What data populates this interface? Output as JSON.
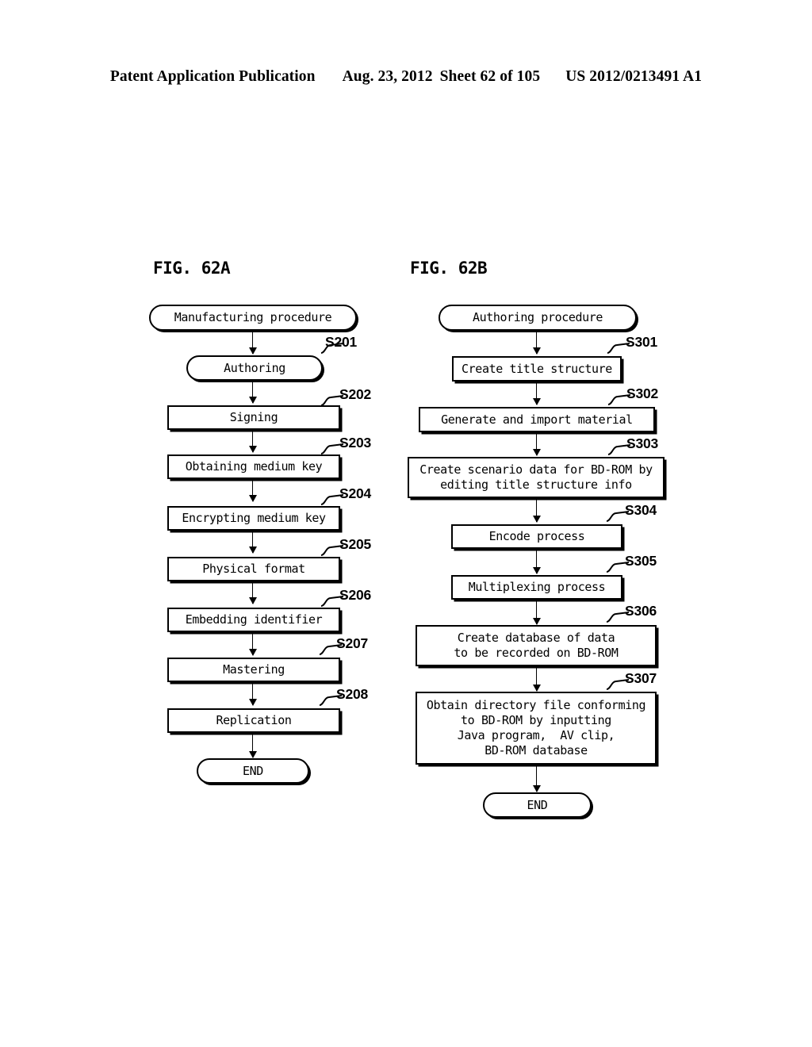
{
  "header": {
    "publication": "Patent Application Publication",
    "date": "Aug. 23, 2012",
    "sheet": "Sheet 62 of 105",
    "patent_number": "US 2012/0213491 A1"
  },
  "figures": [
    {
      "label": "FIG. 62A",
      "nodes": [
        {
          "id": "start",
          "shape": "stadium",
          "text": "Manufacturing procedure",
          "step": null
        },
        {
          "id": "s201",
          "shape": "stadium",
          "text": "Authoring",
          "step": "S201"
        },
        {
          "id": "s202",
          "shape": "rectangle",
          "text": "Signing",
          "step": "S202"
        },
        {
          "id": "s203",
          "shape": "rectangle",
          "text": "Obtaining medium key",
          "step": "S203"
        },
        {
          "id": "s204",
          "shape": "rectangle",
          "text": "Encrypting medium key",
          "step": "S204"
        },
        {
          "id": "s205",
          "shape": "rectangle",
          "text": "Physical format",
          "step": "S205"
        },
        {
          "id": "s206",
          "shape": "rectangle",
          "text": "Embedding identifier",
          "step": "S206"
        },
        {
          "id": "s207",
          "shape": "rectangle",
          "text": "Mastering",
          "step": "S207"
        },
        {
          "id": "s208",
          "shape": "rectangle",
          "text": "Replication",
          "step": "S208"
        },
        {
          "id": "end",
          "shape": "stadium",
          "text": "END",
          "step": null
        }
      ]
    },
    {
      "label": "FIG. 62B",
      "nodes": [
        {
          "id": "start",
          "shape": "stadium",
          "text": "Authoring procedure",
          "step": null
        },
        {
          "id": "s301",
          "shape": "rectangle",
          "text": "Create title structure",
          "step": "S301"
        },
        {
          "id": "s302",
          "shape": "rectangle",
          "text": "Generate and import material",
          "step": "S302"
        },
        {
          "id": "s303",
          "shape": "rectangle",
          "text": "Create scenario data for BD-ROM by\neditiong",
          "step": "S303",
          "lines": [
            "Create scenario data for BD-ROM by",
            "editing title structure info"
          ]
        },
        {
          "id": "s304",
          "shape": "rectangle",
          "text": "Encode process",
          "step": "S304"
        },
        {
          "id": "s305",
          "shape": "rectangle",
          "text": "Multiplexing process",
          "step": "S305"
        },
        {
          "id": "s306",
          "shape": "rectangle",
          "text": "Create database of data",
          "step": "S306",
          "lines": [
            "Create database of data",
            "to be recorded on BD-ROM"
          ]
        },
        {
          "id": "s307",
          "shape": "rectangle",
          "text": "Obtain directory file conforming",
          "step": "S307",
          "lines": [
            "Obtain directory file conforming",
            "to BD-ROM by inputting",
            "Java program,  AV clip,",
            "BD-ROM database"
          ]
        },
        {
          "id": "end",
          "shape": "stadium",
          "text": "END",
          "step": null
        }
      ]
    }
  ],
  "figA": {
    "label": "FIG. 62A",
    "start": "Manufacturing procedure",
    "s201": "Authoring",
    "s202": "Signing",
    "s203": "Obtaining medium key",
    "s204": "Encrypting medium key",
    "s205": "Physical format",
    "s206": "Embedding identifier",
    "s207": "Mastering",
    "s208": "Replication",
    "end": "END",
    "step201": "S201",
    "step202": "S202",
    "step203": "S203",
    "step204": "S204",
    "step205": "S205",
    "step206": "S206",
    "step207": "S207",
    "step208": "S208"
  },
  "figB": {
    "label": "FIG. 62B",
    "start": "Authoring procedure",
    "s301": "Create title structure",
    "s302": "Generate and import material",
    "s303_line1": "Create scenario data for BD-ROM by",
    "s303_line2": "editing title structure info",
    "s304": "Encode process",
    "s305": "Multiplexing process",
    "s306_line1": "Create database of data",
    "s306_line2": "to be recorded on BD-ROM",
    "s307_line1": "Obtain directory file conforming",
    "s307_line2": "to BD-ROM by inputting",
    "s307_line3": "Java program,  AV clip,",
    "s307_line4": "BD-ROM database",
    "end": "END",
    "step301": "S301",
    "step302": "S302",
    "step303": "S303",
    "step304": "S304",
    "step305": "S305",
    "step306": "S306",
    "step307": "S307"
  },
  "colors": {
    "ink": "#000000",
    "paper": "#ffffff"
  }
}
